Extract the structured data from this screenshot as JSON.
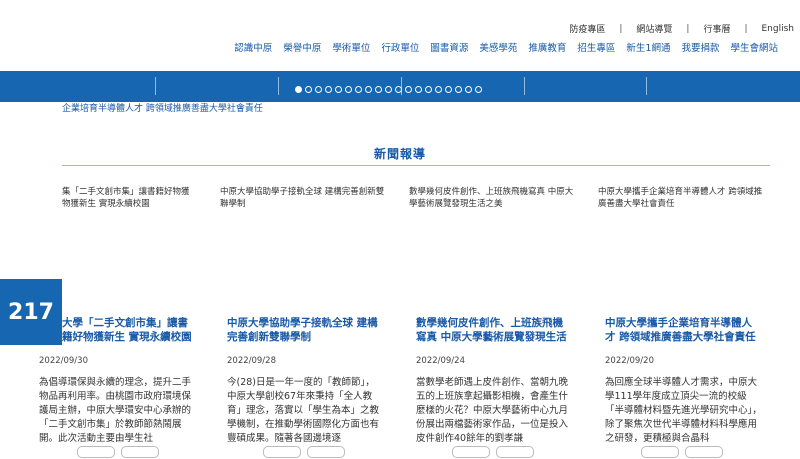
{
  "util_nav": {
    "items": [
      "防疫專區",
      "網站導覽",
      "行事曆",
      "English"
    ],
    "separator": "|"
  },
  "main_nav": {
    "items": [
      "認識中原",
      "榮譽中原",
      "學術單位",
      "行政單位",
      "圖書資源",
      "美感學苑",
      "推廣教育",
      "招生專區",
      "新生1網通",
      "我要捐款",
      "學生會網站"
    ]
  },
  "slider": {
    "slide_count": 19,
    "active_index": 0
  },
  "ticker": {
    "text": "企業培育半導體人才 跨領域推廣善盡大學社會責任"
  },
  "news": {
    "section_title": "新聞報導",
    "count": "217",
    "cards": [
      {
        "thumb_text": "集「二手文創市集」讓書籍好物獲\n物獲新生 實現永續校園",
        "title": "大學「二手文創市集」讓書籍好物獲新生 實現永續校園",
        "date": "2022/09/30",
        "body": "為倡導環保與永續的理念，提升二手物品再利用率。由桃園市政府環境保護局主辦，中原大學環安中心承辦的「二手文創市集」於教師節熱鬧展開。此次活動主要由學生社"
      },
      {
        "thumb_text": "中原大學協助學子接軌全球 建構完善創新雙聯學制",
        "title": "中原大學協助學子接軌全球 建構完善創新雙聯學制",
        "date": "2022/09/28",
        "body": "今(28)日是一年一度的「教師節」，中原大學創校67年來秉持「全人教育」理念，落實以「學生為本」之教學機制，在推動學術國際化方面也有豐碩成果。隨著各國邊境逐"
      },
      {
        "thumb_text": "數學幾何皮件創作、上班族飛機寫真 中原大學藝術展覽發現生活之美",
        "title": "數學幾何皮件創作、上班族飛機寫真 中原大學藝術展覽發現生活",
        "date": "2022/09/24",
        "body": "當數學老師遇上皮件創作、當朝九晚五的上班族拿起攝影相機，會產生什麼樣的火花？中原大學藝術中心九月份展出兩檔藝術家作品，一位是投入皮件創作40餘年的劉孝謙"
      },
      {
        "thumb_text": "中原大學攜手企業培育半導體人才 跨領域推廣善盡大學社會責任",
        "title": "中原大學攜手企業培育半導體人才 跨領域推廣善盡大學社會責任",
        "date": "2022/09/20",
        "body": "為回應全球半導體人才需求，中原大學111學年度成立頂尖一流的校級「半導體材料暨先進光學研究中心」，除了聚焦次世代半導體材料科學應用之研發，更積極與合晶科"
      }
    ]
  },
  "colors": {
    "brand_blue": "#1766b1",
    "link_blue": "#1a5aa6",
    "accent_orange": "#f0a070"
  }
}
